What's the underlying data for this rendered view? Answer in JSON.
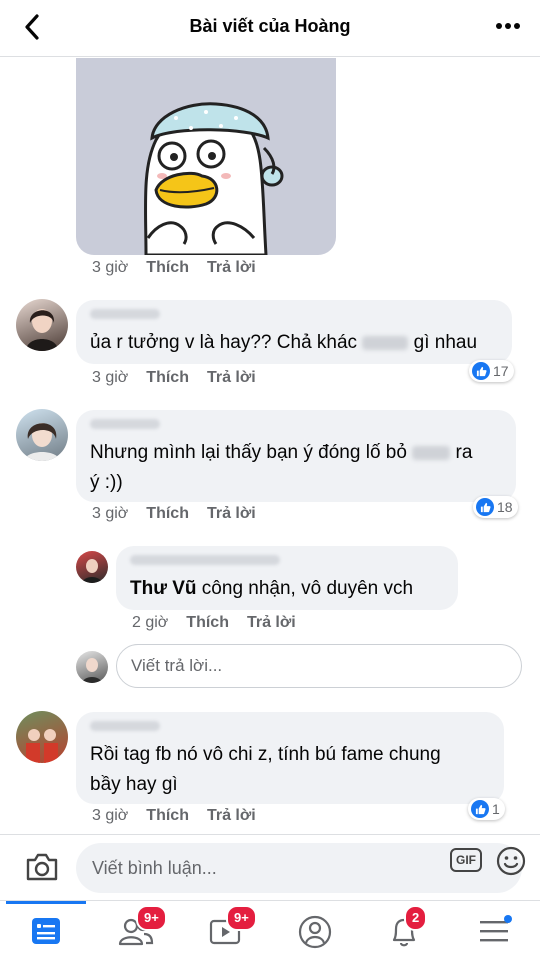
{
  "header": {
    "title": "Bài viết của Hoàng"
  },
  "sticker_meta": {
    "time": "3 giờ",
    "like": "Thích",
    "reply": "Trả lời"
  },
  "comments": [
    {
      "text_before": "ủa r tưởng v là hay?? Chả khác",
      "text_after": "gì nhau",
      "time": "3 giờ",
      "like": "Thích",
      "reply": "Trả lời",
      "reactions": "17"
    },
    {
      "line1_before": "Nhưng mình lại thấy bạn ý đóng lố bỏ",
      "line1_after": "ra",
      "line2": "ý :))",
      "time": "3 giờ",
      "like": "Thích",
      "reply": "Trả lời",
      "reactions": "18"
    },
    {
      "tag": "Thư Vũ",
      "text": " công nhận, vô duyên vch",
      "time": "2 giờ",
      "like": "Thích",
      "reply": "Trả lời"
    },
    {
      "line1": "Rồi tag fb nó vô chi z,  tính bú fame chung",
      "line2": "bầy hay gì",
      "time": "3 giờ",
      "like": "Thích",
      "reply": "Trả lời",
      "reactions": "1"
    }
  ],
  "reply_input": {
    "placeholder": "Viết trả lời..."
  },
  "comment_bar": {
    "placeholder": "Viết bình luận...",
    "gif_label": "GIF"
  },
  "tabbar": {
    "friends_badge": "9+",
    "watch_badge": "9+",
    "notifications_badge": "2"
  },
  "colors": {
    "accent": "#1877f2",
    "badge": "#e41e3f",
    "bubble": "#f0f2f5"
  }
}
